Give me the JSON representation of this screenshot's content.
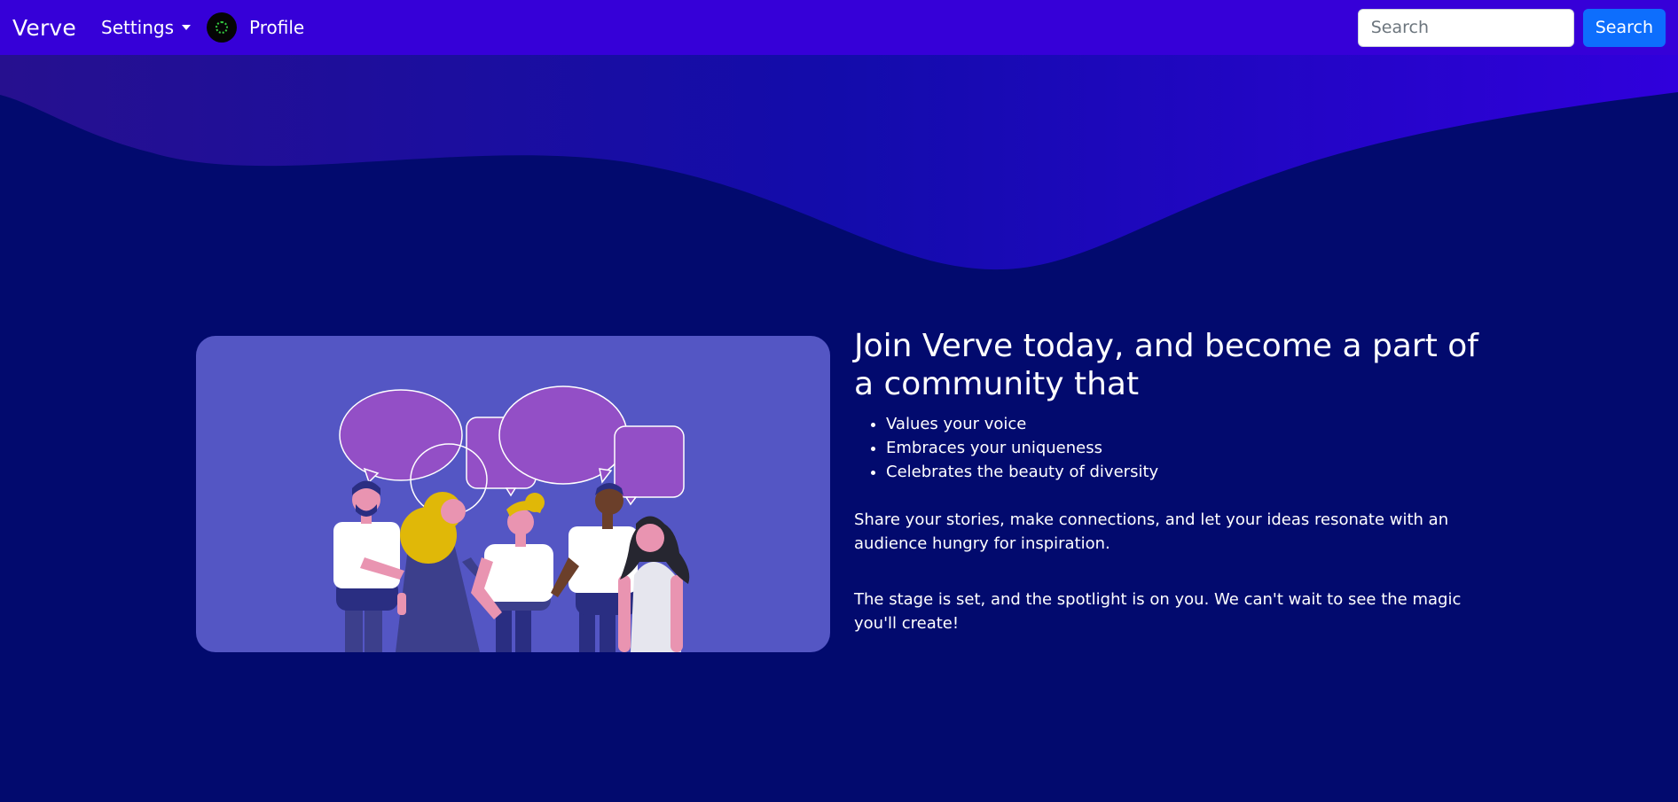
{
  "nav": {
    "brand": "Verve",
    "settings_label": "Settings",
    "profile_label": "Profile",
    "search_placeholder": "Search",
    "search_button": "Search"
  },
  "hero": {
    "headline": "Join Verve today, and become a part of a community that",
    "features": [
      "Values your voice",
      "Embraces your uniqueness",
      "Celebrates the beauty of diversity"
    ],
    "paragraph1": "Share your stories, make connections, and let your ideas resonate with an audience hungry for inspiration.",
    "paragraph2": "The stage is set, and the spotlight is on you. We can't wait to see the magic you'll create!"
  },
  "colors": {
    "navbar": "#3600d8",
    "background": "#020a6e",
    "card": "#5456c4",
    "search_button": "#0d6efd"
  }
}
